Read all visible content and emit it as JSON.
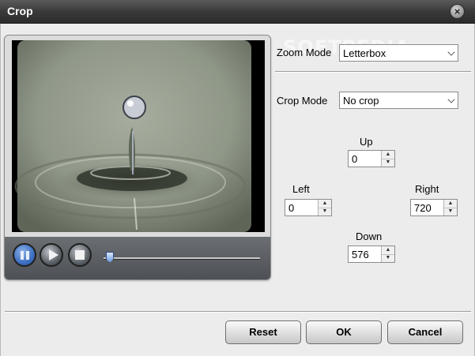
{
  "window": {
    "title": "Crop",
    "close_icon": "×"
  },
  "player": {
    "controls": {
      "pause_icon": "pause-icon",
      "play_icon": "play-icon",
      "stop_icon": "stop-icon"
    },
    "seek_progress": 0.03
  },
  "watermark": "SOFTPEDIA",
  "zoom": {
    "label": "Zoom Mode",
    "value": "Letterbox"
  },
  "crop": {
    "label": "Crop Mode",
    "value": "No crop"
  },
  "margins": {
    "up": {
      "label": "Up",
      "value": "0"
    },
    "left": {
      "label": "Left",
      "value": "0"
    },
    "right": {
      "label": "Right",
      "value": "720"
    },
    "down": {
      "label": "Down",
      "value": "576"
    },
    "spin_up": "▲",
    "spin_down": "▼"
  },
  "buttons": {
    "reset": "Reset",
    "ok": "OK",
    "cancel": "Cancel"
  }
}
